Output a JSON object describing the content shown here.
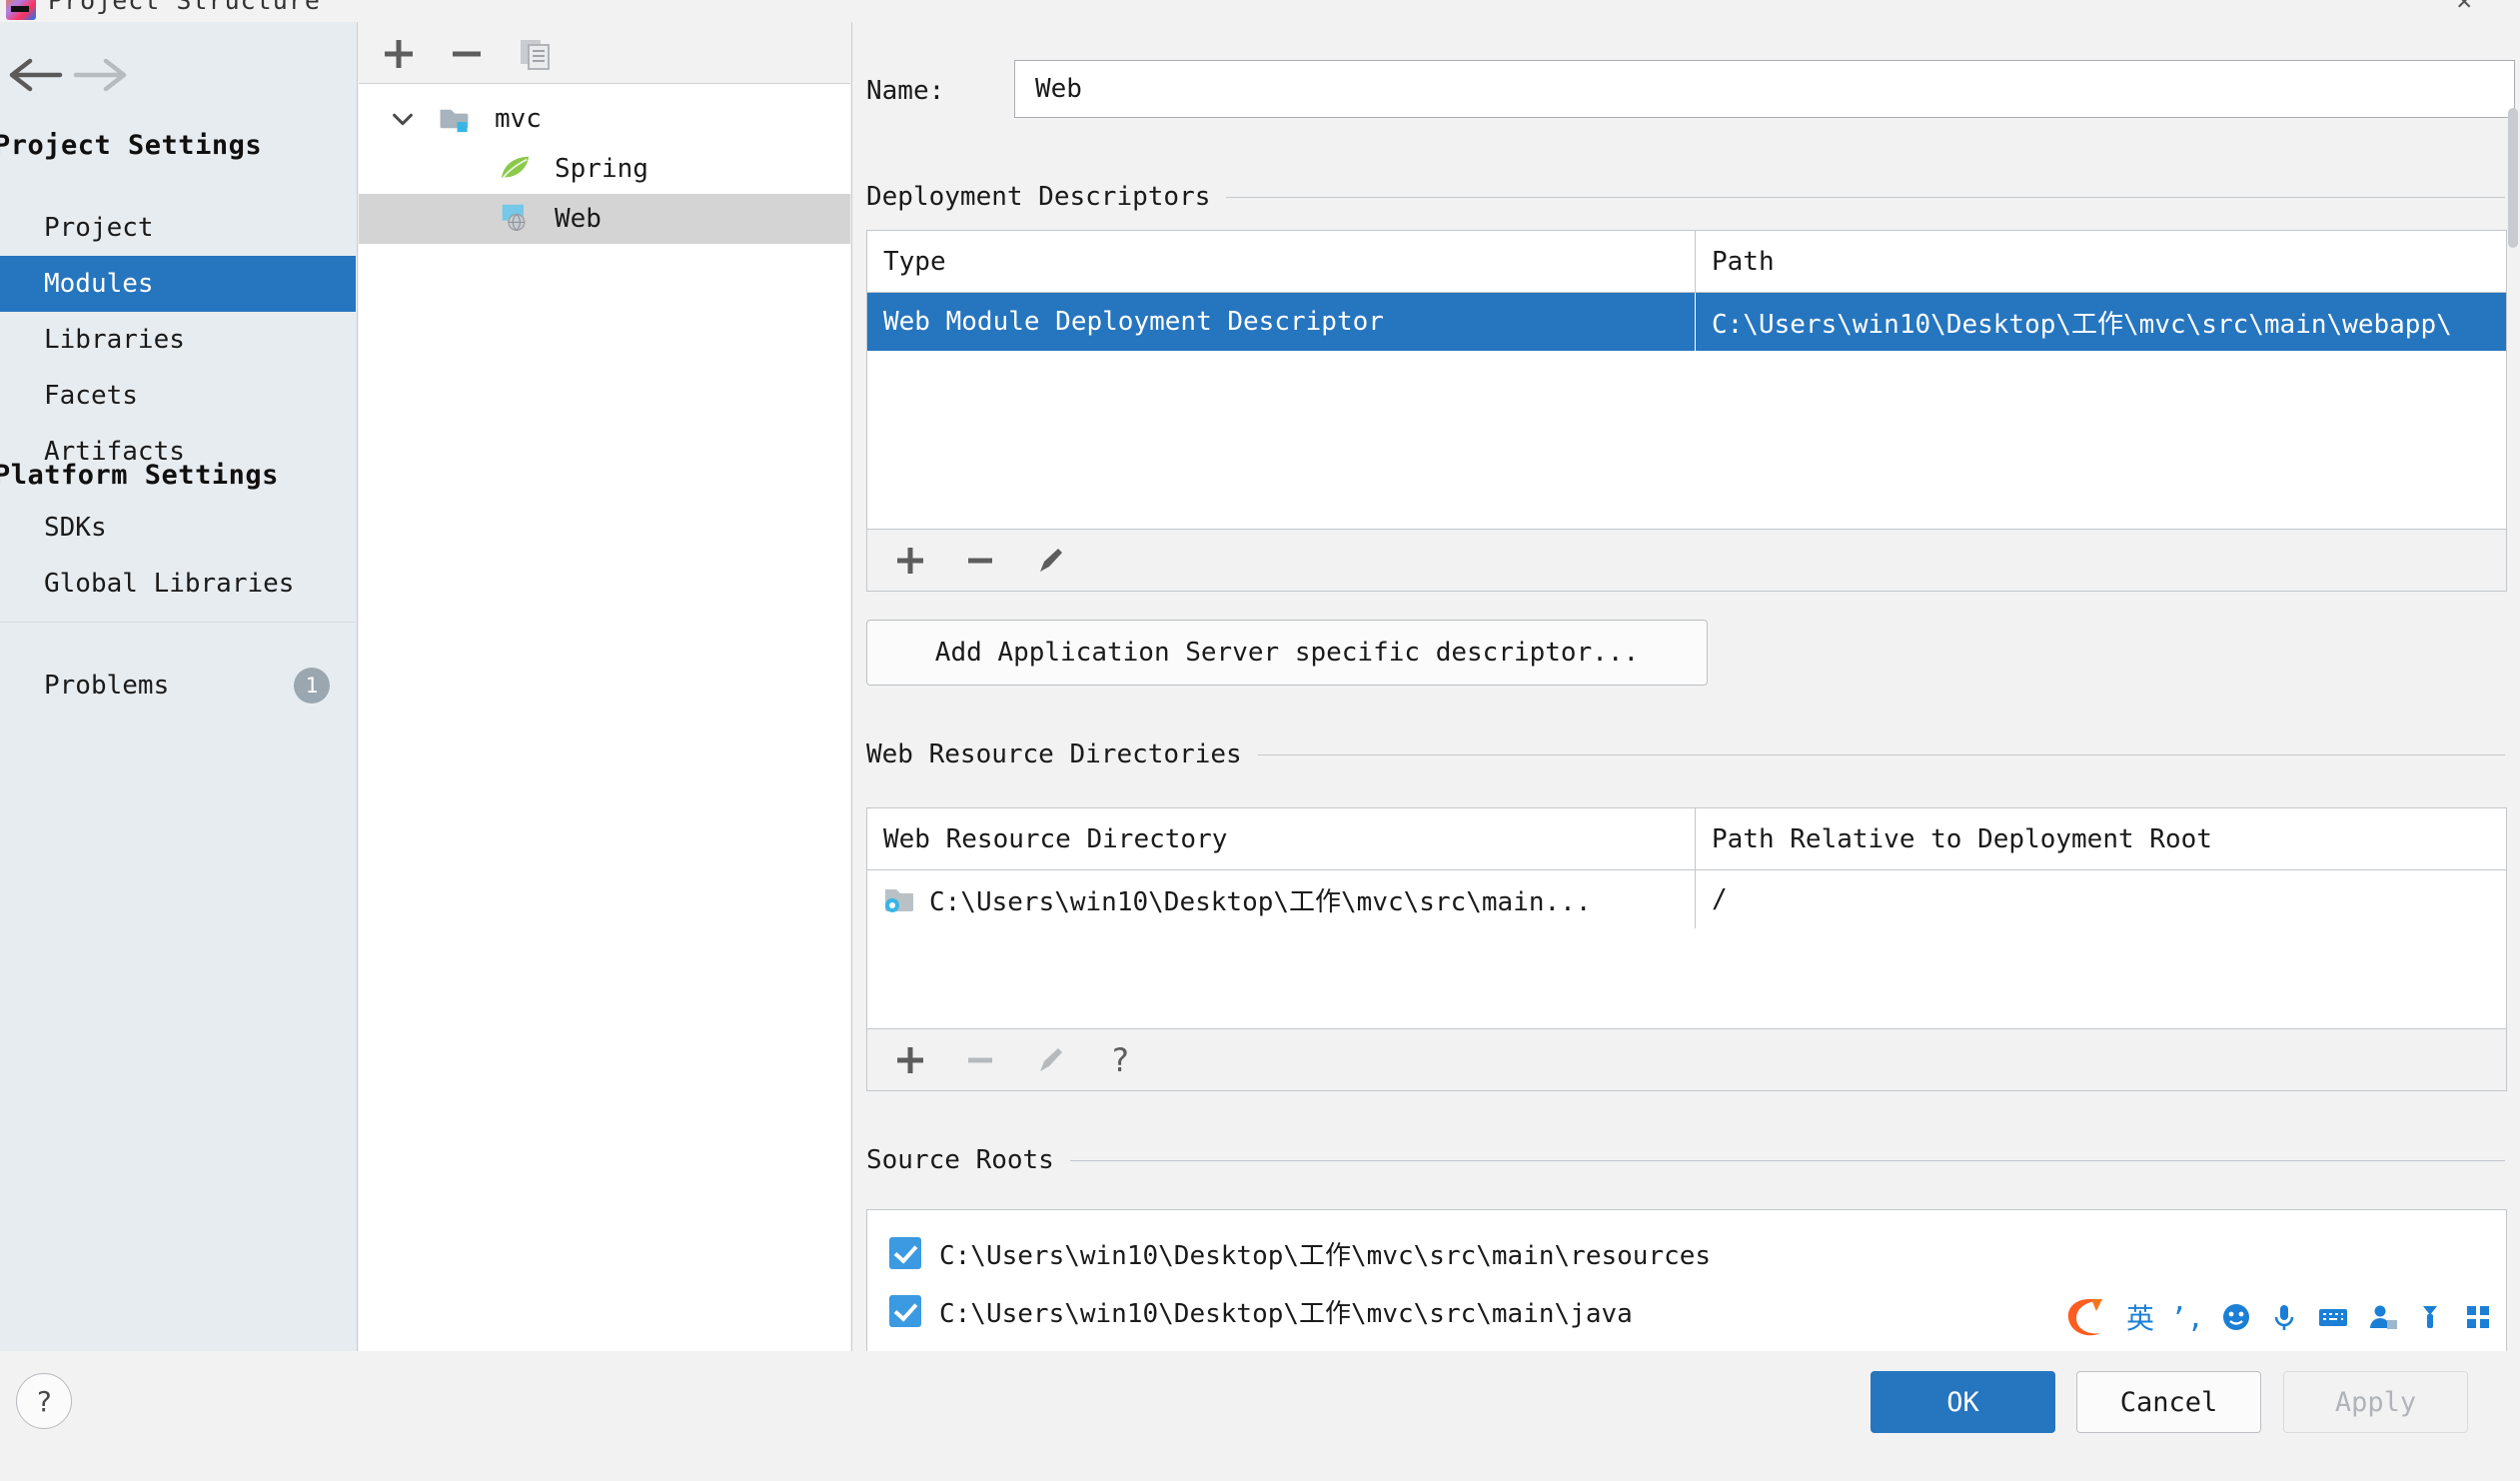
{
  "window": {
    "title": "Project Structure",
    "close_label": "✕",
    "logo_icon": "intellij-idea-logo"
  },
  "sidebar": {
    "back_icon": "arrow-left-icon",
    "forward_icon": "arrow-right-icon",
    "groups": [
      {
        "header": "Project Settings",
        "items": [
          {
            "label": "Project",
            "selected": false
          },
          {
            "label": "Modules",
            "selected": true
          },
          {
            "label": "Libraries",
            "selected": false
          },
          {
            "label": "Facets",
            "selected": false
          },
          {
            "label": "Artifacts",
            "selected": false
          }
        ]
      },
      {
        "header": "Platform Settings",
        "items": [
          {
            "label": "SDKs",
            "selected": false
          },
          {
            "label": "Global Libraries",
            "selected": false
          }
        ]
      }
    ],
    "problems": {
      "label": "Problems",
      "count": "1"
    }
  },
  "tree": {
    "toolbar": {
      "add_label": "+",
      "remove_label": "−",
      "copy_icon": "copy-icon"
    },
    "nodes": [
      {
        "label": "mvc",
        "icon": "module-folder-icon",
        "expanded": true,
        "selected": false,
        "depth": 0
      },
      {
        "label": "Spring",
        "icon": "spring-leaf-icon",
        "selected": false,
        "depth": 1
      },
      {
        "label": "Web",
        "icon": "web-facet-icon",
        "selected": true,
        "depth": 1
      }
    ]
  },
  "content": {
    "name_field": {
      "label": "Name:",
      "value": "Web",
      "placeholder": ""
    },
    "deployment_descriptors": {
      "section_title": "Deployment Descriptors",
      "columns": [
        "Type",
        "Path"
      ],
      "rows": [
        {
          "type": "Web Module Deployment Descriptor",
          "path": "C:\\Users\\win10\\Desktop\\工作\\mvc\\src\\main\\webapp\\",
          "selected": true
        }
      ],
      "toolbar": [
        {
          "icon": "plus-icon",
          "label": "+",
          "disabled": false
        },
        {
          "icon": "minus-icon",
          "label": "−",
          "disabled": false
        },
        {
          "icon": "pencil-edit-icon",
          "label": "✎",
          "disabled": false
        }
      ],
      "add_server_descriptor_button": "Add Application Server specific descriptor..."
    },
    "web_resource_directories": {
      "section_title": "Web Resource Directories",
      "columns": [
        "Web Resource Directory",
        "Path Relative to Deployment Root"
      ],
      "rows": [
        {
          "directory": "C:\\Users\\win10\\Desktop\\工作\\mvc\\src\\main...",
          "directory_icon": "web-folder-icon",
          "relative_path": "/"
        }
      ],
      "toolbar": [
        {
          "icon": "plus-icon",
          "label": "+",
          "disabled": false
        },
        {
          "icon": "minus-icon",
          "label": "−",
          "disabled": true
        },
        {
          "icon": "pencil-edit-icon",
          "label": "✎",
          "disabled": true
        },
        {
          "icon": "help-question-icon",
          "label": "?",
          "disabled": false
        }
      ]
    },
    "source_roots": {
      "section_title": "Source Roots",
      "rows": [
        {
          "label": "C:\\Users\\win10\\Desktop\\工作\\mvc\\src\\main\\resources",
          "checked": true
        },
        {
          "label": "C:\\Users\\win10\\Desktop\\工作\\mvc\\src\\main\\java",
          "checked": true
        }
      ]
    }
  },
  "footer": {
    "help_label": "?",
    "ok_label": "OK",
    "cancel_label": "Cancel",
    "apply_label": "Apply"
  },
  "ime_toolbar": {
    "items": [
      {
        "icon": "sogou-logo-icon",
        "label": "S"
      },
      {
        "icon": "chinese-english-toggle-icon",
        "label": "英"
      },
      {
        "icon": "punctuation-icon",
        "label": "’,"
      },
      {
        "icon": "emoji-icon",
        "label": "☺"
      },
      {
        "icon": "microphone-icon",
        "label": "·"
      },
      {
        "icon": "keyboard-icon",
        "label": "⌨"
      },
      {
        "icon": "user-icon",
        "label": "●"
      },
      {
        "icon": "toolbox-icon",
        "label": "▼"
      },
      {
        "icon": "apps-grid-icon",
        "label": "■"
      }
    ]
  },
  "colors": {
    "accent": "#2675bf",
    "selection": "#2675bf",
    "tree_selection": "#d4d4d4",
    "sidebar_bg": "#e7ecf0",
    "panel_bg": "#f2f2f2",
    "checkbox": "#3b9ae1"
  }
}
